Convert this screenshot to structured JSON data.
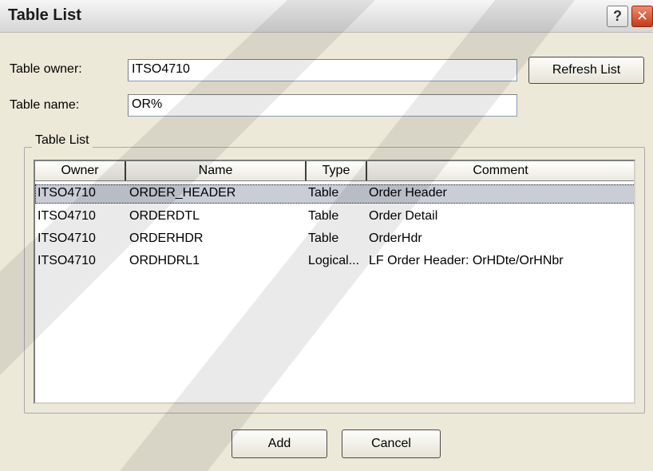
{
  "window": {
    "title": "Table List",
    "help_glyph": "?",
    "close_glyph": "✕"
  },
  "form": {
    "owner_label": "Table owner:",
    "owner_value": "ITSO4710",
    "name_label": "Table name:",
    "name_value": "OR%",
    "refresh_label": "Refresh List"
  },
  "group": {
    "caption": "Table List"
  },
  "table": {
    "columns": [
      "Owner",
      "Name",
      "Type",
      "Comment"
    ],
    "rows": [
      {
        "owner": "ITSO4710",
        "name": "ORDER_HEADER",
        "type": "Table",
        "comment": "Order Header",
        "selected": true
      },
      {
        "owner": "ITSO4710",
        "name": "ORDERDTL",
        "type": "Table",
        "comment": "Order Detail",
        "selected": false
      },
      {
        "owner": "ITSO4710",
        "name": "ORDERHDR",
        "type": "Table",
        "comment": "OrderHdr",
        "selected": false
      },
      {
        "owner": "ITSO4710",
        "name": "ORDHDRL1",
        "type": "Logical...",
        "comment": "LF Order Header: OrHDte/OrHNbr",
        "selected": false
      }
    ]
  },
  "buttons": {
    "add_label": "Add",
    "cancel_label": "Cancel"
  },
  "colors": {
    "dialog_bg": "#ece9d8",
    "selection_bg": "#c9cdd6",
    "close_red": "#c8381a"
  },
  "icons": {
    "help": "help-icon",
    "close": "close-icon"
  }
}
